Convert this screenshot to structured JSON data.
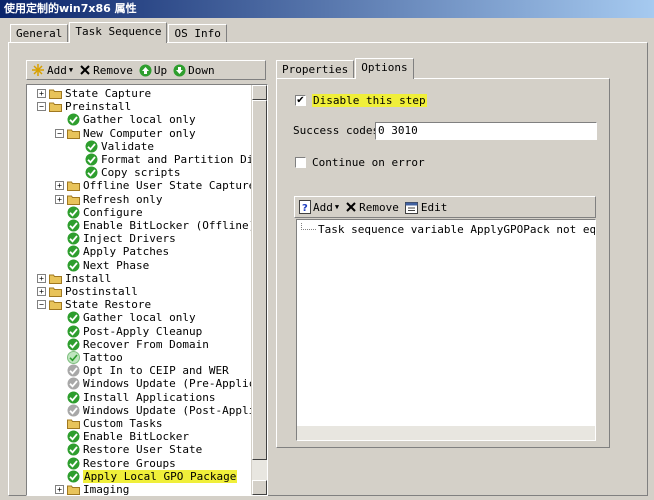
{
  "window": {
    "title": "使用定制的win7x86 属性"
  },
  "tabs": [
    "General",
    "Task Sequence",
    "OS Info"
  ],
  "toolbar": {
    "add": "Add",
    "remove": "Remove",
    "up": "Up",
    "down": "Down"
  },
  "tree": [
    {
      "label": "State Capture",
      "level": 1,
      "type": "folder",
      "exp": "+"
    },
    {
      "label": "Preinstall",
      "level": 1,
      "type": "folder",
      "exp": "-"
    },
    {
      "label": "Gather local only",
      "level": 2,
      "type": "check"
    },
    {
      "label": "New Computer only",
      "level": 2,
      "type": "folder",
      "exp": "-"
    },
    {
      "label": "Validate",
      "level": 3,
      "type": "check"
    },
    {
      "label": "Format and Partition Disk",
      "level": 3,
      "type": "check"
    },
    {
      "label": "Copy scripts",
      "level": 3,
      "type": "check"
    },
    {
      "label": "Offline User State Capture",
      "level": 2,
      "type": "folder",
      "exp": "+"
    },
    {
      "label": "Refresh only",
      "level": 2,
      "type": "folder",
      "exp": "+"
    },
    {
      "label": "Configure",
      "level": 2,
      "type": "check"
    },
    {
      "label": "Enable BitLocker (Offline)",
      "level": 2,
      "type": "check"
    },
    {
      "label": "Inject Drivers",
      "level": 2,
      "type": "check"
    },
    {
      "label": "Apply Patches",
      "level": 2,
      "type": "check"
    },
    {
      "label": "Next Phase",
      "level": 2,
      "type": "check"
    },
    {
      "label": "Install",
      "level": 1,
      "type": "folder",
      "exp": "+"
    },
    {
      "label": "Postinstall",
      "level": 1,
      "type": "folder",
      "exp": "+"
    },
    {
      "label": "State Restore",
      "level": 1,
      "type": "folder",
      "exp": "-"
    },
    {
      "label": "Gather local only",
      "level": 2,
      "type": "check"
    },
    {
      "label": "Post-Apply Cleanup",
      "level": 2,
      "type": "check"
    },
    {
      "label": "Recover From Domain",
      "level": 2,
      "type": "check"
    },
    {
      "label": "Tattoo",
      "level": 2,
      "type": "check-light"
    },
    {
      "label": "Opt In to CEIP and WER",
      "level": 2,
      "type": "gray"
    },
    {
      "label": "Windows Update (Pre-Application",
      "level": 2,
      "type": "gray"
    },
    {
      "label": "Install Applications",
      "level": 2,
      "type": "check"
    },
    {
      "label": "Windows Update (Post-Applicati",
      "level": 2,
      "type": "gray"
    },
    {
      "label": "Custom Tasks",
      "level": 2,
      "type": "folder"
    },
    {
      "label": "Enable BitLocker",
      "level": 2,
      "type": "check"
    },
    {
      "label": "Restore User State",
      "level": 2,
      "type": "check"
    },
    {
      "label": "Restore Groups",
      "level": 2,
      "type": "check"
    },
    {
      "label": "Apply Local GPO Package",
      "level": 2,
      "type": "check",
      "highlight": true
    },
    {
      "label": "Imaging",
      "level": 2,
      "type": "folder",
      "exp": "+"
    }
  ],
  "right_tabs": [
    "Properties",
    "Options"
  ],
  "options": {
    "disable_label": "Disable this step",
    "disable_checked": true,
    "success_codes_label": "Success codes:",
    "success_codes_value": "0 3010",
    "continue_on_error_label": "Continue on error",
    "continue_on_error_checked": false
  },
  "condition_toolbar": {
    "add": "Add",
    "remove": "Remove",
    "edit": "Edit"
  },
  "conditions": [
    "Task sequence variable ApplyGPOPack not equals NO"
  ],
  "colors": {
    "highlight": "#f0ef3a",
    "check_green": "#2e9e2e",
    "folder": "#e8c35a"
  }
}
